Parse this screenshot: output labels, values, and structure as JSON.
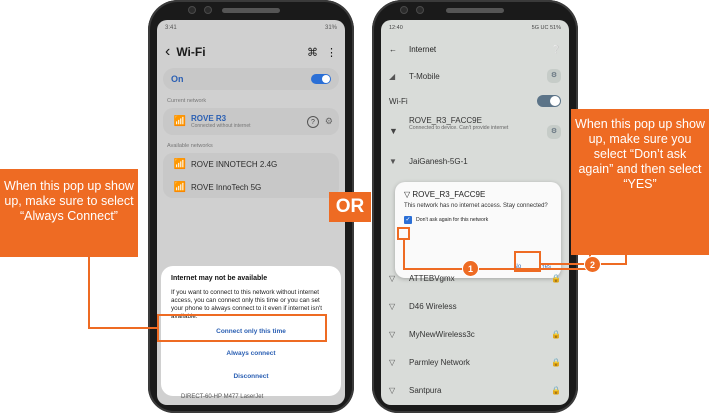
{
  "colors": {
    "accent": "#ee6b23",
    "link_blue": "#2a5fb3",
    "toggle_blue": "#2b6fd6"
  },
  "left_callout": "When this pop up show up, make sure to select “Always Connect”",
  "right_callout": "When this pop up show up, make sure you select “Don’t ask again” and then select “YES”",
  "or_label": "OR",
  "steps": {
    "one": "1",
    "two": "2"
  },
  "phone1": {
    "status_left": "3:41",
    "status_right": "31%",
    "title": "Wi-Fi",
    "on_label": "On",
    "current_section": "Current network",
    "current": {
      "name": "ROVE R3",
      "sub": "Connected without internet"
    },
    "available_section": "Available networks",
    "networks": [
      "ROVE INNOTECH 2.4G",
      "ROVE InnoTech 5G"
    ],
    "bottom_network": "DIRECT-60-HP M477 LaserJet",
    "dialog": {
      "title": "Internet may not be available",
      "body": "If you want to connect to this network without internet access, you can connect only this time or you can set your phone to always connect to it even if internet isn't available.",
      "opt_once": "Connect only this time",
      "opt_always": "Always connect",
      "opt_disconnect": "Disconnect"
    }
  },
  "phone2": {
    "status_left": "12:40",
    "status_right": "5G UC 51%",
    "title": "Internet",
    "tmobile": "T-Mobile",
    "wifi_label": "Wi-Fi",
    "rove": {
      "name": "ROVE_R3_FACC9E",
      "sub": "Connected to device. Can't provide internet"
    },
    "jai": "JaiGanesh-5G-1",
    "dialog": {
      "title": "ROVE_R3_FACC9E",
      "body": "This network has no internet access. Stay connected?",
      "checkbox": "Don't ask again for this network",
      "no": "No",
      "yes": "Yes"
    },
    "networks": [
      "ATTEBVgmx",
      "D46 Wireless",
      "MyNewWireless3c",
      "Parmley Network",
      "Santpura"
    ]
  }
}
